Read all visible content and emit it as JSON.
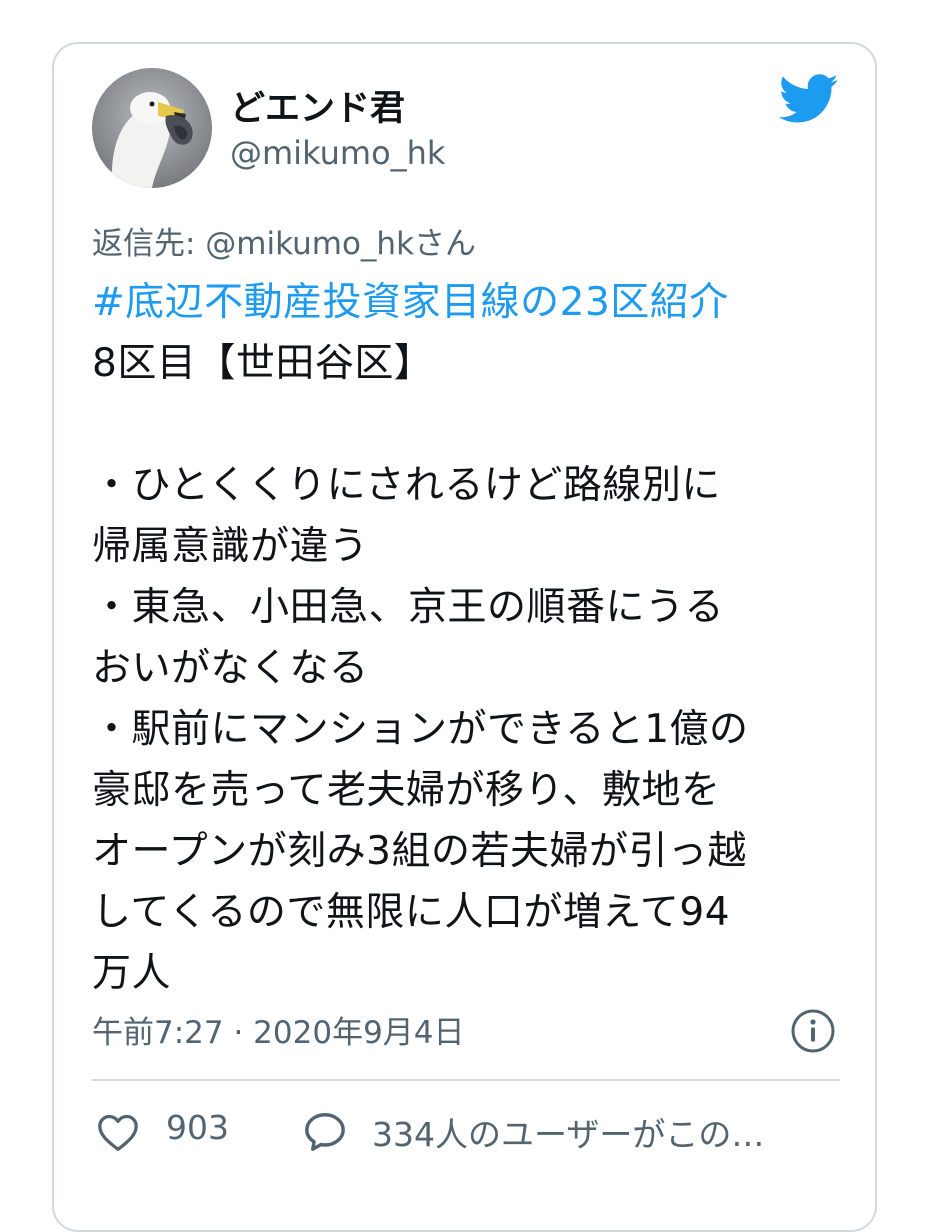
{
  "tweet": {
    "author": {
      "display_name": "どエンド君",
      "handle": "@mikumo_hk"
    },
    "reply_to": "返信先: @mikumo_hkさん",
    "hashtag": "#底辺不動産投資家目線の23区紹介",
    "lines": [
      "8区目【世田谷区】",
      "",
      "・ひとくくりにされるけど路線別に",
      "帰属意識が違う",
      "・東急、小田急、京王の順番にうる",
      "おいがなくなる",
      "・駅前にマンションができると1億の",
      "豪邸を売って老夫婦が移り、敷地を",
      "オープンが刻み3組の若夫婦が引っ越",
      "してくるので無限に人口が増えて94",
      "万人"
    ],
    "timestamp": "午前7:27 · 2020年9月4日",
    "like_count": "903",
    "reply_summary": "334人のユーザーがこの…"
  },
  "icons": {
    "avatar": "goose-avatar",
    "brand": "twitter-bird-icon",
    "info": "info-icon",
    "like": "heart-icon",
    "reply": "speech-bubble-icon"
  },
  "colors": {
    "brand_blue": "#1d9bf0",
    "text": "#0f1419",
    "secondary": "#536471",
    "border": "#cfd9de"
  }
}
